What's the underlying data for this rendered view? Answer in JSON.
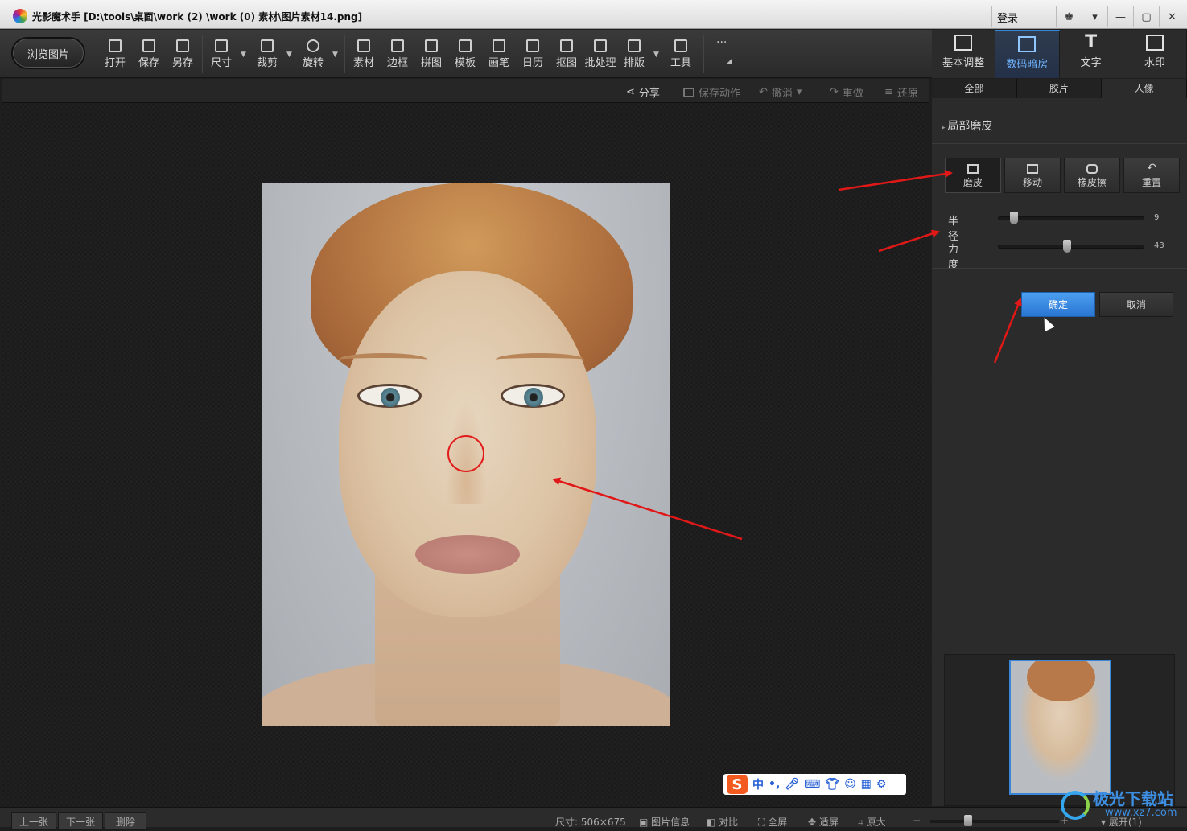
{
  "title": "光影魔术手 [D:\\tools\\桌面\\work (2) \\work (0) 素材\\图片素材14.png]",
  "login": "登录",
  "toolbar": {
    "browse": "浏览图片",
    "tools": [
      "打开",
      "保存",
      "另存",
      "尺寸",
      "裁剪",
      "旋转",
      "素材",
      "边框",
      "拼图",
      "模板",
      "画笔",
      "日历",
      "抠图",
      "批处理",
      "排版",
      "工具"
    ]
  },
  "right_tabs": [
    "基本调整",
    "数码暗房",
    "文字",
    "水印"
  ],
  "actions": {
    "share": "分享",
    "save_action": "保存动作",
    "undo": "撤消",
    "redo": "重做",
    "restore": "还原"
  },
  "panel": {
    "subtabs": [
      "全部",
      "胶片",
      "人像"
    ],
    "section_title": "局部磨皮",
    "modes": [
      "磨皮",
      "移动",
      "橡皮擦",
      "重置"
    ],
    "radius_label": "半径",
    "radius_value": "9",
    "radius_level": 0.09,
    "strength_label": "力度",
    "strength_value": "43",
    "strength_level": 0.47,
    "ok": "确定",
    "cancel": "取消"
  },
  "ime": {
    "logo": "S",
    "mode": "中"
  },
  "status": {
    "prev": "上一张",
    "next": "下一张",
    "delete": "删除",
    "size": "尺寸: 506×675",
    "info": "图片信息",
    "compare": "对比",
    "fullscreen": "全屏",
    "fit": "适屏",
    "original": "原大",
    "expand": "展开(1)"
  },
  "watermark": {
    "name": "极光下载站",
    "url": "www.xz7.com"
  }
}
